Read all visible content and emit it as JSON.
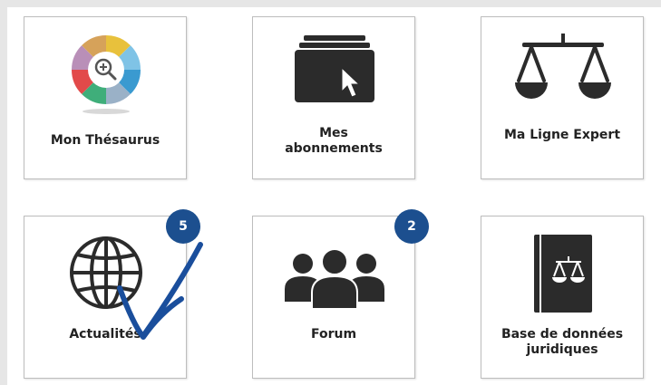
{
  "tiles": [
    {
      "label": "Mon Thésaurus",
      "icon": "thesaurus-icon"
    },
    {
      "label_line1": "Mes",
      "label_line2": "abonnements",
      "icon": "folder-cursor-icon"
    },
    {
      "label": "Ma Ligne Expert",
      "icon": "scales-icon"
    },
    {
      "label": "Actualités",
      "icon": "globe-icon",
      "badge": "5"
    },
    {
      "label": "Forum",
      "icon": "people-group-icon",
      "badge": "2"
    },
    {
      "label_line1": "Base de données",
      "label_line2": "juridiques",
      "icon": "law-book-icon"
    }
  ],
  "colors": {
    "badge": "#1c4f8f",
    "icon_dark": "#2b2b2b",
    "annotation_arrow": "#1a4e9c"
  }
}
